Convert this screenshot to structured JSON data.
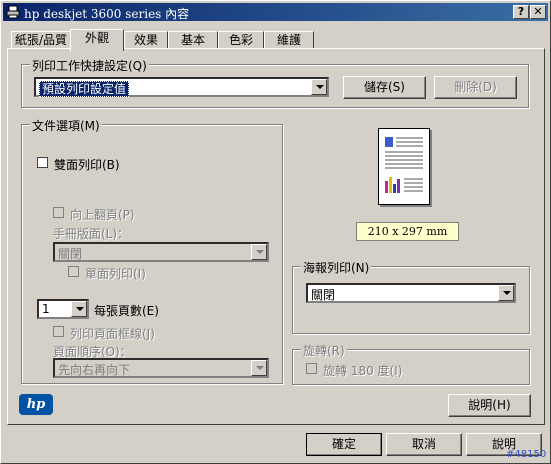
{
  "window": {
    "title": "hp deskjet 3600 series 內容",
    "help_btn": "?",
    "close_btn": "✕"
  },
  "tabs": [
    "紙張/品質",
    "外觀",
    "效果",
    "基本",
    "色彩",
    "維護"
  ],
  "active_tab": "外觀",
  "quick_set": {
    "label": "列印工作快捷設定(Q)",
    "value": "預設列印設定值",
    "save": "儲存(S)",
    "delete": "刪除(D)"
  },
  "doc_options": {
    "label": "文件選項(M)",
    "duplex": "雙面列印(B)",
    "flip_up": "向上翻頁(P)",
    "booklet_label": "手冊版面(L)：",
    "booklet_value": "關閉",
    "single_page": "單面列印(I)",
    "pages_per_sheet_value": "1",
    "pages_per_sheet_label": "每張頁數(E)",
    "print_borders": "列印頁面框線(J)",
    "page_order_label": "頁面順序(O)：",
    "page_order_value": "先向右再向下"
  },
  "paper_size": "210 x 297 mm",
  "poster": {
    "label": "海報列印(N)",
    "value": "關閉"
  },
  "rotation": {
    "label": "旋轉(R)",
    "rotate180": "旋轉 180 度(I)"
  },
  "help_button": "說明(H)",
  "logo": "hp",
  "footer": {
    "ok": "確定",
    "cancel": "取消",
    "help": "說明"
  },
  "watermark": "#48150"
}
